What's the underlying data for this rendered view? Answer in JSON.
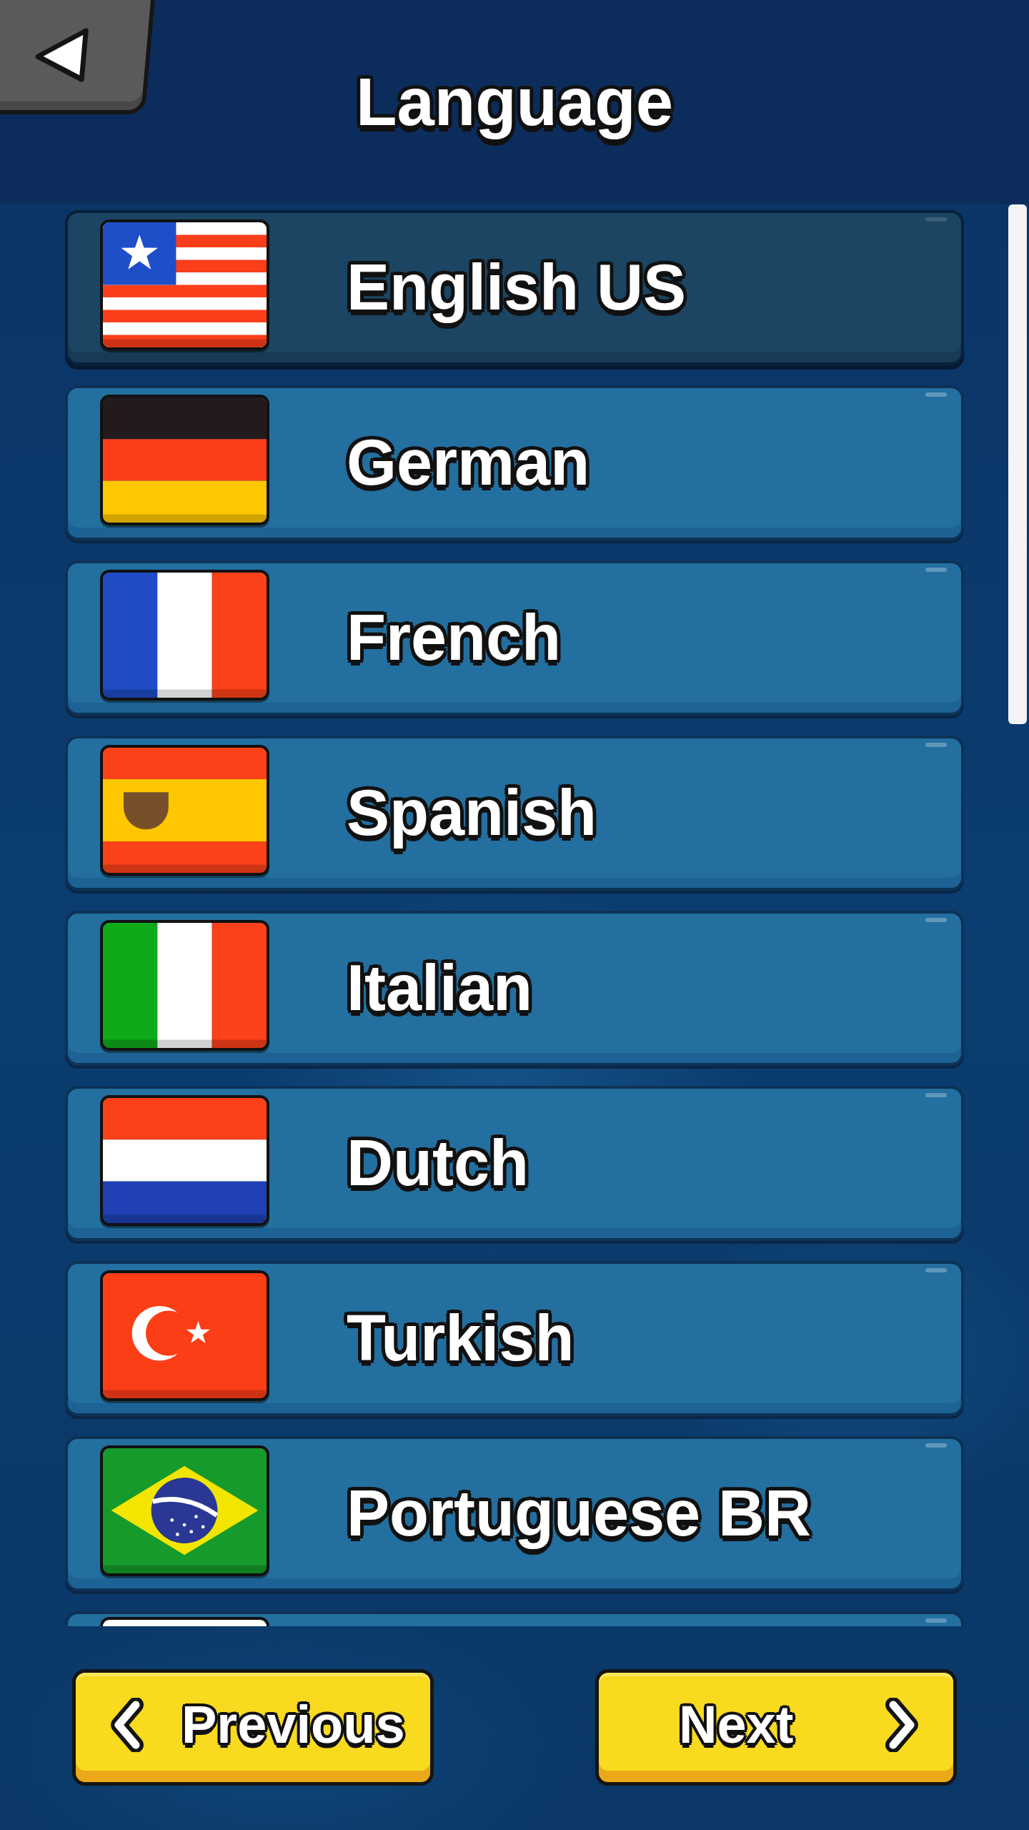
{
  "title": "Language",
  "languages": [
    {
      "label": "English US",
      "kind": "us",
      "selected": true,
      "cut_off": false
    },
    {
      "label": "German",
      "kind": "de",
      "selected": false,
      "cut_off": false
    },
    {
      "label": "French",
      "kind": "fr",
      "selected": false,
      "cut_off": false
    },
    {
      "label": "Spanish",
      "kind": "es",
      "selected": false,
      "cut_off": false
    },
    {
      "label": "Italian",
      "kind": "it",
      "selected": false,
      "cut_off": false
    },
    {
      "label": "Dutch",
      "kind": "nl",
      "selected": false,
      "cut_off": false
    },
    {
      "label": "Turkish",
      "kind": "tr",
      "selected": false,
      "cut_off": false
    },
    {
      "label": "Portuguese BR",
      "kind": "br",
      "selected": false,
      "cut_off": false
    },
    {
      "kind": "blank",
      "selected": false,
      "cut_off": true
    }
  ],
  "buttons": [
    {
      "label": "Previous",
      "kind": "previous"
    },
    {
      "label": "Next",
      "kind": "next"
    }
  ]
}
